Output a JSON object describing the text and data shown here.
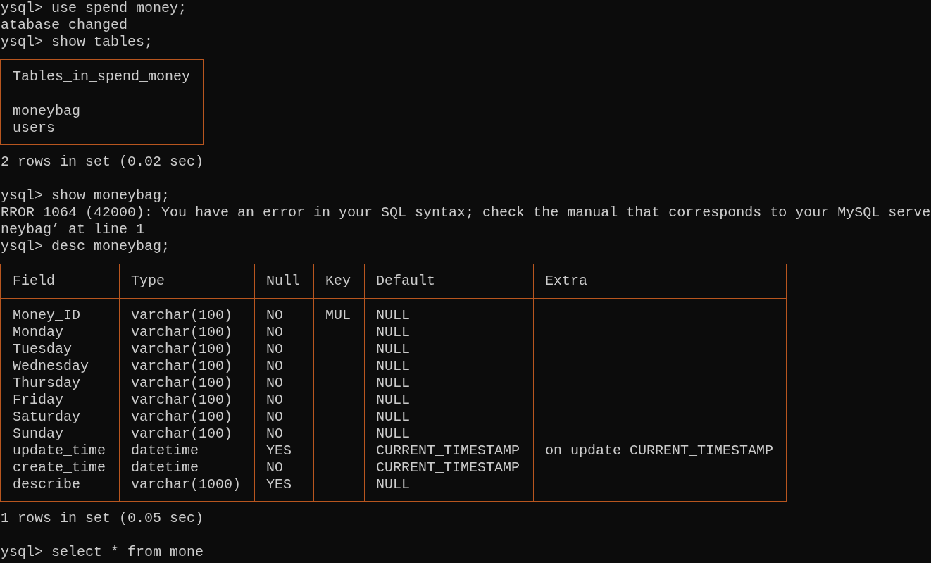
{
  "lines": [
    {
      "kind": "text",
      "text": "ysql> use spend_money;"
    },
    {
      "kind": "text",
      "text": "atabase changed"
    },
    {
      "kind": "text",
      "text": "ysql> show tables;"
    },
    {
      "kind": "table",
      "columns": [
        "Tables_in_spend_money"
      ],
      "rows": [
        [
          "moneybag"
        ],
        [
          "users"
        ]
      ]
    },
    {
      "kind": "text",
      "text": "2 rows in set (0.02 sec)"
    },
    {
      "kind": "blank"
    },
    {
      "kind": "text",
      "text": "ysql> show moneybag;"
    },
    {
      "kind": "text",
      "text": "RROR 1064 (42000): You have an error in your SQL syntax; check the manual that corresponds to your MySQL serve"
    },
    {
      "kind": "text",
      "text": "neybag’ at line 1"
    },
    {
      "kind": "text",
      "text": "ysql> desc moneybag;"
    },
    {
      "kind": "table",
      "columns": [
        "Field",
        "Type",
        "Null",
        "Key",
        "Default",
        "Extra"
      ],
      "rows": [
        [
          "Money_ID",
          "varchar(100)",
          "NO",
          "MUL",
          "NULL",
          null
        ],
        [
          "Monday",
          "varchar(100)",
          "NO",
          null,
          "NULL",
          null
        ],
        [
          "Tuesday",
          "varchar(100)",
          "NO",
          null,
          "NULL",
          null
        ],
        [
          "Wednesday",
          "varchar(100)",
          "NO",
          null,
          "NULL",
          null
        ],
        [
          "Thursday",
          "varchar(100)",
          "NO",
          null,
          "NULL",
          null
        ],
        [
          "Friday",
          "varchar(100)",
          "NO",
          null,
          "NULL",
          null
        ],
        [
          "Saturday",
          "varchar(100)",
          "NO",
          null,
          "NULL",
          null
        ],
        [
          "Sunday",
          "varchar(100)",
          "NO",
          null,
          "NULL",
          null
        ],
        [
          "update_time",
          "datetime",
          "YES",
          null,
          "CURRENT_TIMESTAMP",
          "on update CURRENT_TIMESTAMP"
        ],
        [
          "create_time",
          "datetime",
          "NO",
          null,
          "CURRENT_TIMESTAMP",
          null
        ],
        [
          "describe",
          "varchar(1000)",
          "YES",
          null,
          "NULL",
          null
        ]
      ]
    },
    {
      "kind": "text",
      "text": "1 rows in set (0.05 sec)"
    },
    {
      "kind": "blank"
    },
    {
      "kind": "text",
      "text": "ysql> select * from mone"
    }
  ]
}
